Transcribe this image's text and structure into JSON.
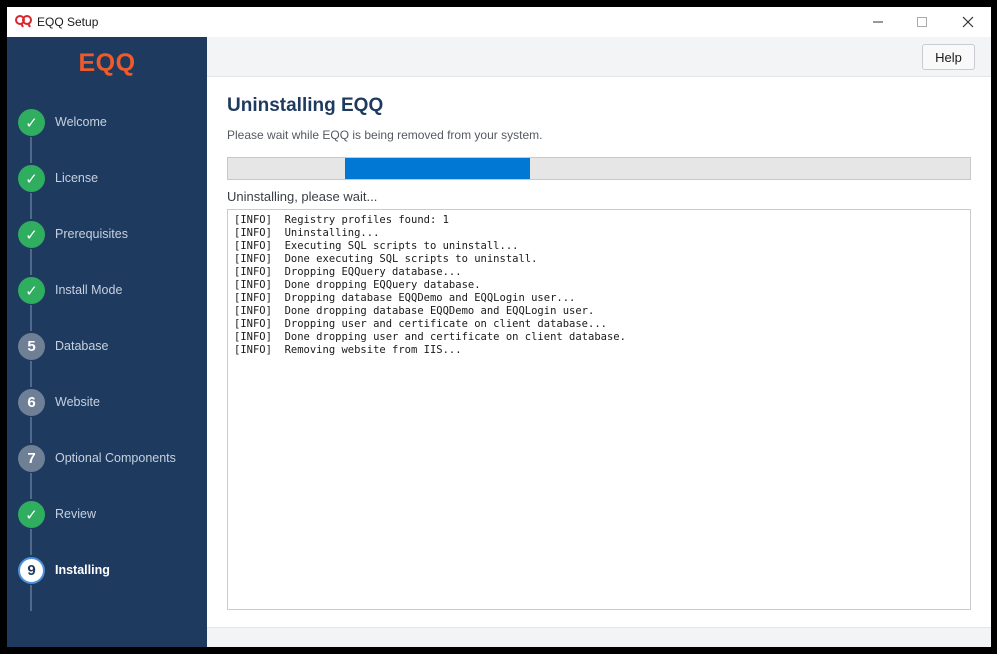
{
  "window": {
    "title": "EQQ Setup"
  },
  "sidebar": {
    "brand": "EQQ",
    "steps": [
      {
        "number": "✓",
        "label": "Welcome",
        "state": "done"
      },
      {
        "number": "✓",
        "label": "License",
        "state": "done"
      },
      {
        "number": "✓",
        "label": "Prerequisites",
        "state": "done"
      },
      {
        "number": "✓",
        "label": "Install Mode",
        "state": "done"
      },
      {
        "number": "5",
        "label": "Database",
        "state": "pending"
      },
      {
        "number": "6",
        "label": "Website",
        "state": "pending"
      },
      {
        "number": "7",
        "label": "Optional Components",
        "state": "pending"
      },
      {
        "number": "✓",
        "label": "Review",
        "state": "done"
      },
      {
        "number": "9",
        "label": "Installing",
        "state": "current"
      }
    ]
  },
  "toolbar": {
    "help_label": "Help"
  },
  "main": {
    "title": "Uninstalling EQQ",
    "subtitle": "Please wait while EQQ is being removed from your system.",
    "status": "Uninstalling, please wait...",
    "progress": {
      "segment_start": 0.158,
      "segment_end": 0.408
    }
  },
  "log": {
    "lines": [
      "[INFO]  Registry profiles found: 1",
      "[INFO]  Uninstalling...",
      "[INFO]  Executing SQL scripts to uninstall...",
      "[INFO]  Done executing SQL scripts to uninstall.",
      "[INFO]  Dropping EQQuery database...",
      "[INFO]  Done dropping EQQuery database.",
      "[INFO]  Dropping database EQQDemo and EQQLogin user...",
      "[INFO]  Done dropping database EQQDemo and EQQLogin user.",
      "[INFO]  Dropping user and certificate on client database...",
      "[INFO]  Done dropping user and certificate on client database.",
      "[INFO]  Removing website from IIS..."
    ]
  },
  "colors": {
    "sidebar_bg": "#1f3a5f",
    "brand": "#f05a28",
    "done": "#2fae5f",
    "pending": "#6f7f96",
    "progress": "#0078d4"
  }
}
